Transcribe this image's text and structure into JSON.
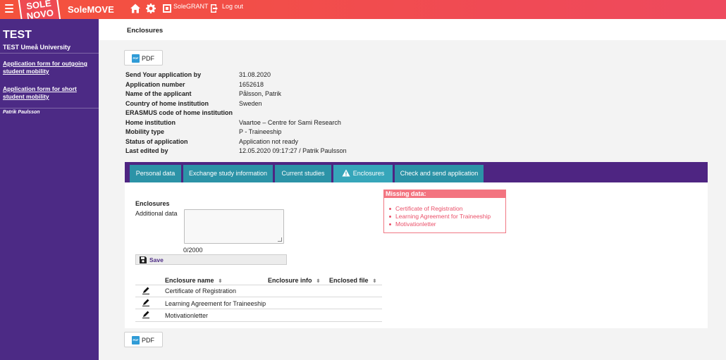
{
  "topbar": {
    "logo_line1": "SOLE",
    "logo_line2": "NOVO",
    "app_name": "SoleMOVE",
    "home_icon": "home-icon",
    "settings_icon": "gear-icon",
    "grant_icon": "square-icon",
    "grant_label": "SoleGRANT",
    "logout_icon": "logout-icon",
    "logout_label": "Log out"
  },
  "sidebar": {
    "title": "TEST",
    "subtitle": "TEST Umeå University",
    "links": [
      "Application form for outgoing student mobility",
      "Application form for short student mobility"
    ],
    "user": "Patrik Paulsson"
  },
  "page": {
    "title": "Enclosures",
    "pdf_label": "PDF"
  },
  "info": [
    {
      "label": "Send Your application by",
      "value": "31.08.2020"
    },
    {
      "label": "Application number",
      "value": "1652618"
    },
    {
      "label": "Name of the applicant",
      "value": "Pålsson, Patrik"
    },
    {
      "label": "Country of home institution",
      "value": "Sweden"
    },
    {
      "label": "ERASMUS code of home institution",
      "value": ""
    },
    {
      "label": "Home institution",
      "value": "Vaartoe – Centre for Sami Research"
    },
    {
      "label": "Mobility type",
      "value": "P - Traineeship"
    },
    {
      "label": "Status of application",
      "value": "Application not ready"
    },
    {
      "label": "Last edited by",
      "value": "12.05.2020 09:17:27 / Patrik Paulsson"
    }
  ],
  "tabs": [
    {
      "label": "Personal data"
    },
    {
      "label": "Exchange study information"
    },
    {
      "label": "Current studies"
    },
    {
      "label": "Enclosures",
      "active": true
    },
    {
      "label": "Check and send application"
    }
  ],
  "form": {
    "section_title": "Enclosures",
    "additional_label": "Additional data",
    "additional_value": "",
    "counter": "0/2000",
    "save_label": "Save"
  },
  "missing": {
    "title": "Missing data:",
    "items": [
      "Certificate of Registration",
      "Learning Agreement for Traineeship",
      "Motivationletter"
    ]
  },
  "table": {
    "columns": [
      "Enclosure name",
      "Enclosure info",
      "Enclosed file"
    ],
    "sort_glyph": "⬍",
    "rows": [
      {
        "name": "Certificate of Registration",
        "info": "",
        "file": ""
      },
      {
        "name": "Learning Agreement for Traineeship",
        "info": "",
        "file": ""
      },
      {
        "name": "Motivationletter",
        "info": "",
        "file": ""
      }
    ]
  },
  "colors": {
    "topbar": "#f04a55",
    "sidebar": "#4c2a85",
    "tab": "#2c93a7",
    "tab_active": "#36a6ba",
    "missing": "#f37480"
  }
}
